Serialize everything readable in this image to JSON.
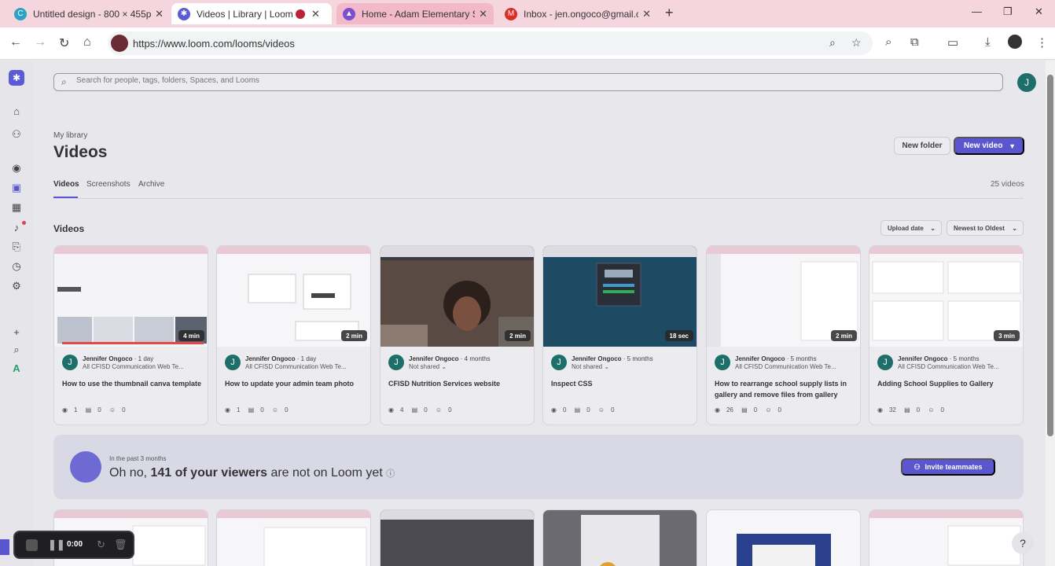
{
  "browser": {
    "tabs": [
      {
        "title": "Untitled design - 800 × 455px",
        "close": "✕"
      },
      {
        "title": "Videos | Library | Loom",
        "close": "✕"
      },
      {
        "title": "Home - Adam Elementary Scho",
        "close": "✕"
      },
      {
        "title": "Inbox - jen.ongoco@gmail.com",
        "close": "✕"
      }
    ],
    "new_tab": "+",
    "url": "https://www.loom.com/looms/videos"
  },
  "search": {
    "placeholder": "Search for people, tags, folders, Spaces, and Looms"
  },
  "user": {
    "initial": "J"
  },
  "header": {
    "breadcrumb": "My library",
    "title": "Videos",
    "new_folder": "New folder",
    "new_video": "New video"
  },
  "subtabs": [
    "Videos",
    "Screenshots",
    "Archive"
  ],
  "video_count": "25 videos",
  "section": {
    "title": "Videos",
    "sort_field": "Upload date",
    "sort_order": "Newest to Oldest"
  },
  "cards": [
    {
      "duration": "4 min",
      "author": "Jennifer Ongoco",
      "age": "· 1 day",
      "sharing": "All CFISD Communication Web Te...",
      "title": "How to use the thumbnail canva template",
      "views": "1",
      "comments": "0",
      "reactions": "0"
    },
    {
      "duration": "2 min",
      "author": "Jennifer Ongoco",
      "age": "· 1 day",
      "sharing": "All CFISD Communication Web Te...",
      "title": "How to update your admin team photo",
      "views": "1",
      "comments": "0",
      "reactions": "0"
    },
    {
      "duration": "2 min",
      "author": "Jennifer Ongoco",
      "age": "· 4 months",
      "sharing": "Not shared ⌄",
      "title": "CFISD Nutrition Services website",
      "views": "4",
      "comments": "0",
      "reactions": "0"
    },
    {
      "duration": "18 sec",
      "author": "Jennifer Ongoco",
      "age": "· 5 months",
      "sharing": "Not shared ⌄",
      "title": "Inspect CSS",
      "views": "0",
      "comments": "0",
      "reactions": "0"
    },
    {
      "duration": "2 min",
      "author": "Jennifer Ongoco",
      "age": "· 5 months",
      "sharing": "All CFISD Communication Web Te...",
      "title": "How to rearrange school supply lists in gallery and remove files from gallery",
      "views": "26",
      "comments": "0",
      "reactions": "0"
    },
    {
      "duration": "3 min",
      "author": "Jennifer Ongoco",
      "age": "· 5 months",
      "sharing": "All CFISD Communication Web Te...",
      "title": "Adding School Supplies to Gallery",
      "views": "32",
      "comments": "0",
      "reactions": "0"
    }
  ],
  "banner": {
    "small": "In the past 3 months",
    "prefix": "Oh no, ",
    "highlight": "141 of your viewers",
    "suffix": " are not on Loom yet",
    "button": "Invite teammates"
  },
  "recorder": {
    "time": "0:00"
  },
  "help": "?",
  "colors": {
    "accent": "#5a56d0",
    "avatar": "#1e6f6b",
    "tabbar": "#f5d6df"
  }
}
